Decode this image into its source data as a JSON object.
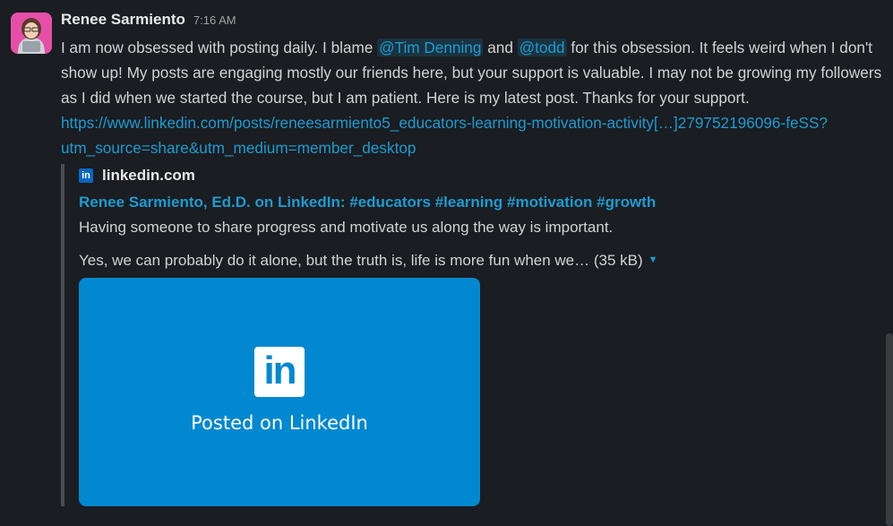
{
  "message": {
    "author": "Renee Sarmiento",
    "time": "7:16 AM",
    "text_1": "I am now obsessed with posting daily. I blame ",
    "mention_1": "@Tim Denning",
    "text_2": " and ",
    "mention_2": "@todd",
    "text_3": " for this obsession. It feels weird when I don't show up! My posts are engaging mostly our friends here, but your support is valuable. I may not be growing my followers as I did when we started the course, but I am patient. Here is my latest post. Thanks for your support. ",
    "link": "https://www.linkedin.com/posts/reneesarmiento5_educators-learning-motivation-activity[…]279752196096-feSS?utm_source=share&utm_medium=member_desktop"
  },
  "unfurl": {
    "site_icon": "in",
    "site_name": "linkedin.com",
    "title": "Renee Sarmiento, Ed.D. on LinkedIn: #educators #learning #motivation #growth",
    "description_1": "Having someone to share progress and motivate us along the way is important.",
    "description_2": "Yes, we can probably do it alone, but the truth is, life is more fun when we… (35 kB)",
    "preview_logo": "in",
    "preview_caption": "Posted on LinkedIn"
  },
  "colors": {
    "background": "#1a1d21",
    "link": "#1d9bd1",
    "linkedin_blue": "#0288d1",
    "avatar_bg": "#e64fa8"
  }
}
